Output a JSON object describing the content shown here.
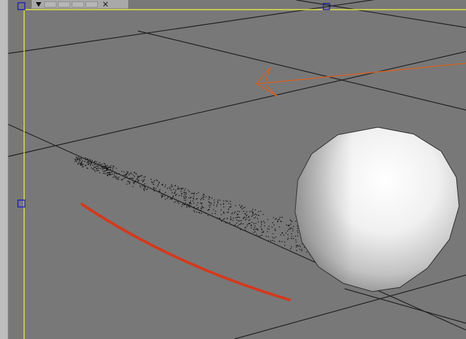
{
  "toolbar": {
    "close_label": "×"
  },
  "colors": {
    "viewport_bg": "#787878",
    "grid_line": "#1e1e1e",
    "frame_yellow": "#e6e640",
    "handle_blue": "#1e1eb4",
    "light_arrow": "#c8642d",
    "red_stroke": "#d23a1e",
    "sphere_highlight": "#ffffff",
    "sphere_shadow": "#8a8a8a"
  },
  "icons": {
    "dropdown": "triangle-down-icon",
    "close": "close-icon"
  }
}
